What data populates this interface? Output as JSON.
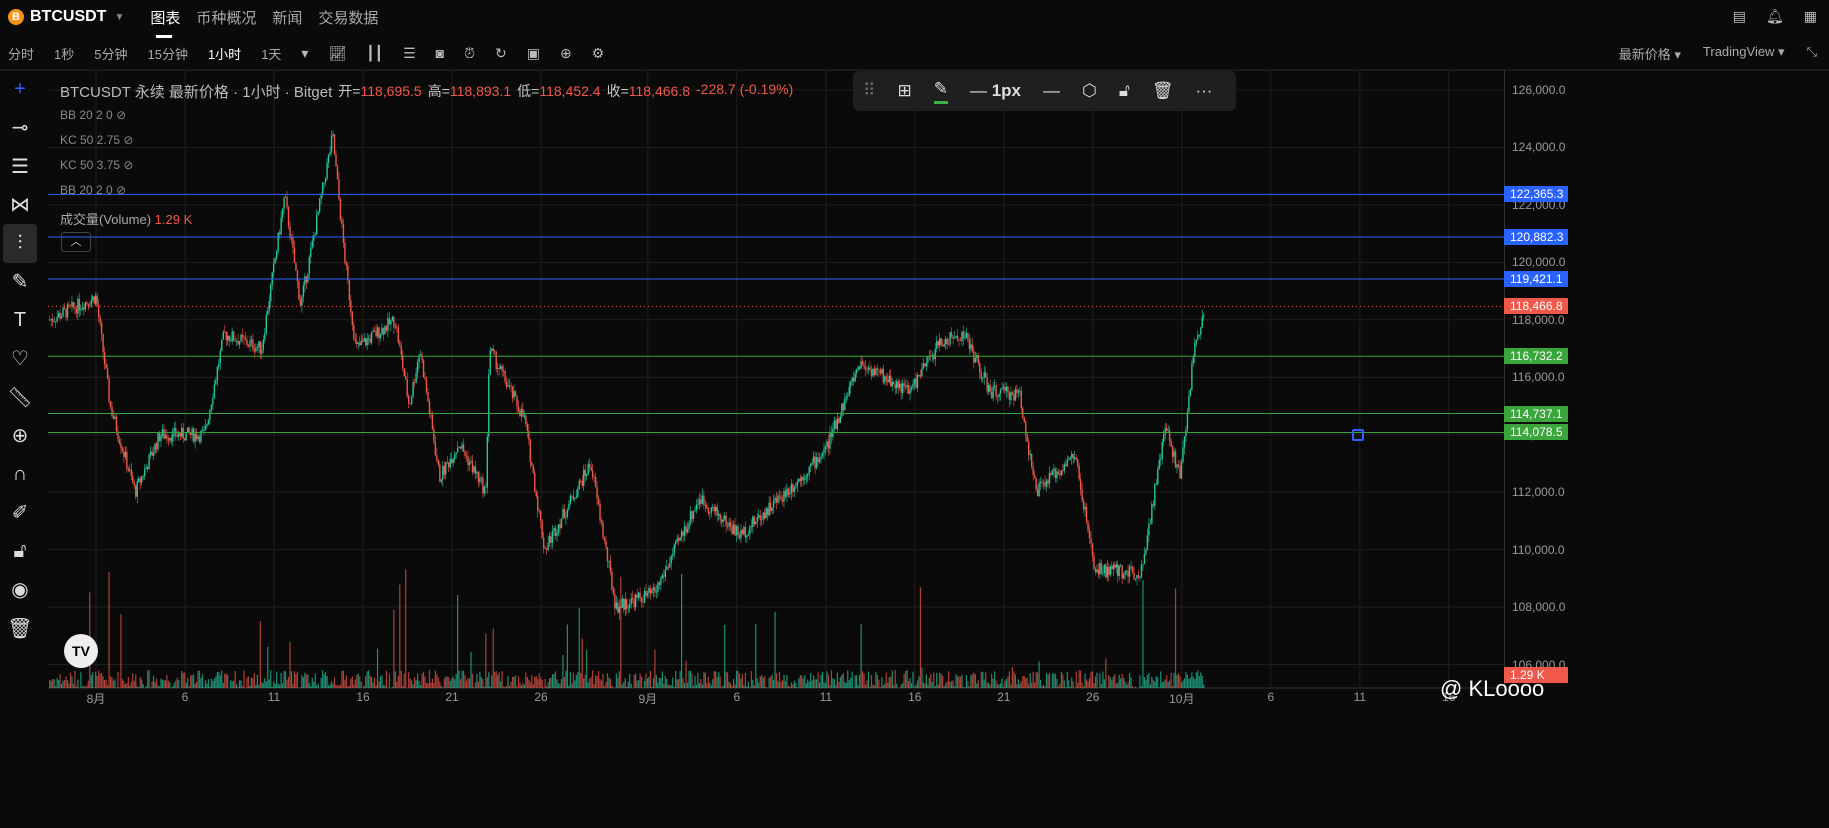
{
  "header": {
    "symbol": "BTCUSDT",
    "coin_letter": "B",
    "tabs": [
      "图表",
      "币种概况",
      "新闻",
      "交易数据"
    ]
  },
  "timeframes": [
    "分时",
    "1秒",
    "5分钟",
    "15分钟",
    "1小时",
    "1天"
  ],
  "toolbar_right": {
    "price_type": "最新价格 ▾",
    "chart_type": "TradingView ▾"
  },
  "legend": {
    "title": "BTCUSDT 永续 最新价格 · 1小时 · Bitget",
    "open_label": "开=",
    "open": "118,695.5",
    "high_label": "高=",
    "high": "118,893.1",
    "low_label": "低=",
    "low": "118,452.4",
    "close_label": "收=",
    "close": "118,466.8",
    "change": "-228.7 (-0.19%)"
  },
  "indicators": [
    "BB 20 2 0",
    "KC 50 2.75",
    "KC 50 3.75",
    "BB 20 2 0"
  ],
  "volume": {
    "label": "成交量(Volume)",
    "value": "1.29 K"
  },
  "drawing_toolbar": {
    "width_label": "1px"
  },
  "price_axis": [
    "126,000.0",
    "124,000.0",
    "122,000.0",
    "120,000.0",
    "118,000.0",
    "116,000.0",
    "114,000.0",
    "112,000.0",
    "110,000.0",
    "108,000.0",
    "106,000.0"
  ],
  "watermark": "@ KLoooo",
  "logo": "TV",
  "chart_data": {
    "type": "candlestick",
    "title": "BTCUSDT 1h",
    "x_ticks": [
      {
        "day": 0,
        "label": "8月"
      },
      {
        "day": 5,
        "label": "6"
      },
      {
        "day": 10,
        "label": "11"
      },
      {
        "day": 15,
        "label": "16"
      },
      {
        "day": 20,
        "label": "21"
      },
      {
        "day": 25,
        "label": "26"
      },
      {
        "day": 31,
        "label": "9月"
      },
      {
        "day": 36,
        "label": "6"
      },
      {
        "day": 41,
        "label": "11"
      },
      {
        "day": 46,
        "label": "16"
      },
      {
        "day": 51,
        "label": "21"
      },
      {
        "day": 56,
        "label": "26"
      },
      {
        "day": 61,
        "label": "10月"
      },
      {
        "day": 66,
        "label": "6"
      },
      {
        "day": 71,
        "label": "11"
      },
      {
        "day": 76,
        "label": "16"
      }
    ],
    "ylim": [
      105500,
      127000
    ],
    "path_days": [
      -2.6,
      0,
      0.8,
      2.2,
      3.6,
      6.1,
      7.2,
      9.3,
      10.6,
      11.5,
      13.3,
      14,
      14.6,
      16.8,
      17.6,
      18.2,
      19.3,
      20.4,
      21.9,
      22.1,
      24.1,
      25.2,
      27.8,
      29.2,
      31.4,
      33.9,
      36.2,
      39.6,
      41,
      42.9,
      45.7,
      47.4,
      48.8,
      50.2,
      51.9,
      52.8,
      55,
      56.1,
      58.7,
      60.1,
      60.9,
      61.7,
      62.3
    ],
    "path_prices": [
      118000,
      118800,
      115000,
      112000,
      114000,
      114000,
      117500,
      117000,
      122300,
      118500,
      124400,
      120000,
      117000,
      118000,
      115000,
      117000,
      112500,
      113700,
      112000,
      117000,
      114500,
      110000,
      113000,
      108000,
      108500,
      111800,
      110500,
      112500,
      113500,
      116500,
      115500,
      117200,
      117500,
      115500,
      115400,
      112000,
      113300,
      109300,
      109200,
      114300,
      112500,
      117000,
      118466.8
    ],
    "hlines": [
      {
        "price": 122365.3,
        "label": "122,365.3",
        "color": "#2962ff"
      },
      {
        "price": 120882.3,
        "label": "120,882.3",
        "color": "#2962ff"
      },
      {
        "price": 119421.1,
        "label": "119,421.1",
        "color": "#2962ff"
      },
      {
        "price": 116732.2,
        "label": "116,732.2",
        "color": "#3aa53a"
      },
      {
        "price": 114737.1,
        "label": "114,737.1",
        "color": "#3aa53a"
      },
      {
        "price": 114078.5,
        "label": "114,078.5",
        "color": "#3aa53a"
      }
    ],
    "last_price": {
      "price": 118466.8,
      "label": "118,466.8",
      "color": "#f0584a"
    },
    "up_color": "#26c6a0",
    "down_color": "#f0584a"
  }
}
